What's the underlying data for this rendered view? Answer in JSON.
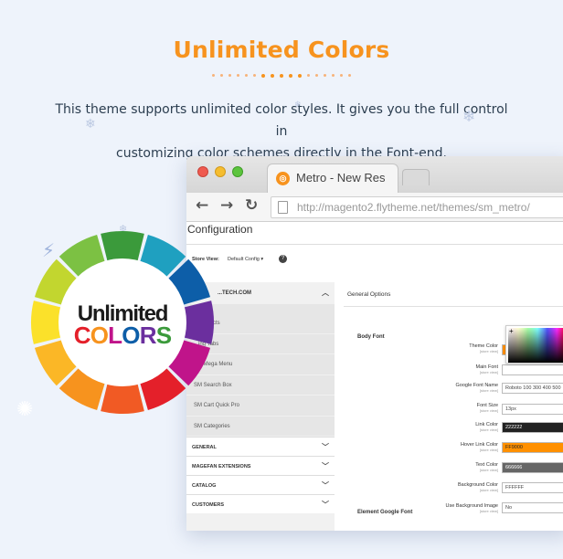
{
  "header": {
    "title": "Unlimited Colors",
    "description_line1": "This theme supports unlimited color styles. It gives you the full control in",
    "description_line2": "customizing color schemes directly in the Font-end."
  },
  "badge": {
    "word1": "Unlimited",
    "word2": "COLORS"
  },
  "browser": {
    "tab_title": "Metro - New Res",
    "url": "http://magento2.flytheme.net/themes/sm_metro/",
    "back_icon": "arrow-left-icon",
    "forward_icon": "arrow-right-icon",
    "reload_icon": "reload-icon"
  },
  "page": {
    "heading": "Configuration",
    "store_view_label": "Store View:",
    "store_view_value": "Default Config ▾"
  },
  "sidebar": {
    "head": "...TECH.COM",
    "items": [
      "...Products",
      "...ing Tabs",
      "SM Mega Menu",
      "SM Search Box",
      "SM Cart Quick Pro",
      "SM Categories"
    ],
    "sections": [
      "GENERAL",
      "MAGEFAN EXTENSIONS",
      "CATALOG",
      "CUSTOMERS"
    ]
  },
  "main": {
    "general_options": "General Options",
    "body_font": "Body Font",
    "element_google_font": "Element Google Font",
    "store_view_note": "[store view]",
    "fields": [
      {
        "label": "Theme Color",
        "value": "FF9000",
        "bg": "#ff9000",
        "fg": "#222222"
      },
      {
        "label": "Main Font",
        "value": "",
        "bg": "#ffffff",
        "fg": "#444444"
      },
      {
        "label": "Google Font Name",
        "value": "Roboto 100 300 400 500",
        "bg": "#ffffff",
        "fg": "#444444"
      },
      {
        "label": "Font Size",
        "value": "13px",
        "bg": "#ffffff",
        "fg": "#444444"
      },
      {
        "label": "Link Color",
        "value": "222222",
        "bg": "#222222",
        "fg": "#ffffff"
      },
      {
        "label": "Hover Link Color",
        "value": "FF9000",
        "bg": "#ff9000",
        "fg": "#222222"
      },
      {
        "label": "Text Color",
        "value": "666666",
        "bg": "#666666",
        "fg": "#ffffff"
      },
      {
        "label": "Background Color",
        "value": "FFFFFF",
        "bg": "#ffffff",
        "fg": "#444444"
      },
      {
        "label": "Use Background Image",
        "value": "No",
        "bg": "#ffffff",
        "fg": "#444444"
      }
    ]
  },
  "colors": {
    "accent": "#f7931e",
    "wheel": [
      "#3b9a3b",
      "#1fa0c0",
      "#0d5ea8",
      "#6b2f9e",
      "#c0148a",
      "#e4202a",
      "#f15a24",
      "#f7931e",
      "#fbb726",
      "#fbe12a",
      "#c2d62f",
      "#7cc143"
    ]
  }
}
